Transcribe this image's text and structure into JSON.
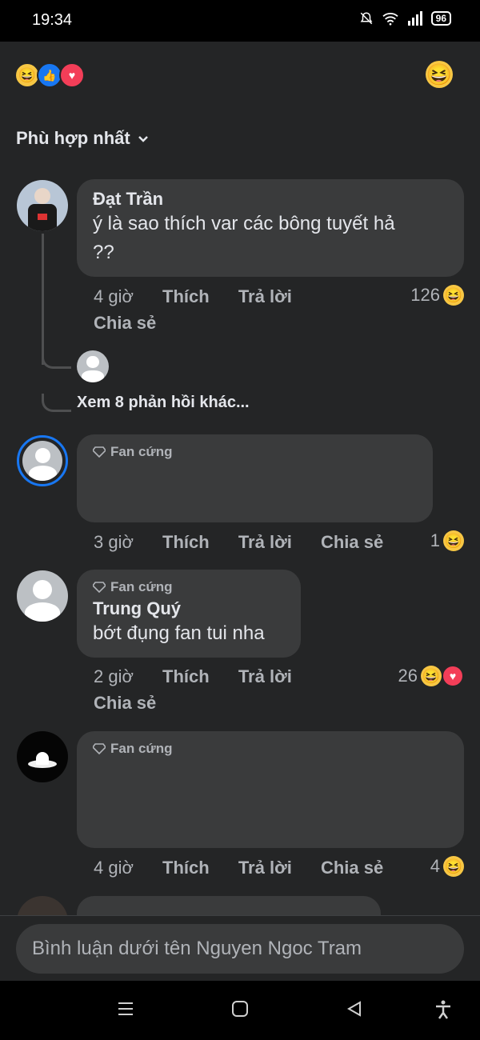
{
  "status": {
    "time": "19:34",
    "battery": "96"
  },
  "sort_label": "Phù hợp nhất",
  "comments": [
    {
      "name": "Đạt Trần",
      "text": "ý là sao thích var các bông tuyết hả ??",
      "time": "4 giờ",
      "like": "Thích",
      "reply": "Trả lời",
      "share": "Chia sẻ",
      "reactions": "126"
    },
    {
      "badge": "Fan cứng",
      "time": "3 giờ",
      "like": "Thích",
      "reply": "Trả lời",
      "share": "Chia sẻ",
      "reactions": "1"
    },
    {
      "badge": "Fan cứng",
      "name": "Trung Quý",
      "text": "bớt đụng fan tui nha",
      "time": "2 giờ",
      "like": "Thích",
      "reply": "Trả lời",
      "share": "Chia sẻ",
      "reactions": "26"
    },
    {
      "badge": "Fan cứng",
      "time": "4 giờ",
      "like": "Thích",
      "reply": "Trả lời",
      "share": "Chia sẻ",
      "reactions": "4"
    }
  ],
  "more_replies": "Xem 8 phản hồi khác...",
  "comment_input": {
    "placeholder": "Bình luận dưới tên Nguyen Ngoc Tram"
  },
  "colors": {
    "background": "#242526",
    "bubble": "#3a3b3c",
    "accent": "#1877f2"
  },
  "icons": [
    "bell-off-icon",
    "wifi-icon",
    "signal-icon",
    "battery-icon",
    "chevron-down-icon",
    "diamond-icon",
    "haha-icon",
    "like-icon",
    "love-icon",
    "menu-icon",
    "home-icon",
    "back-icon",
    "accessibility-icon"
  ]
}
